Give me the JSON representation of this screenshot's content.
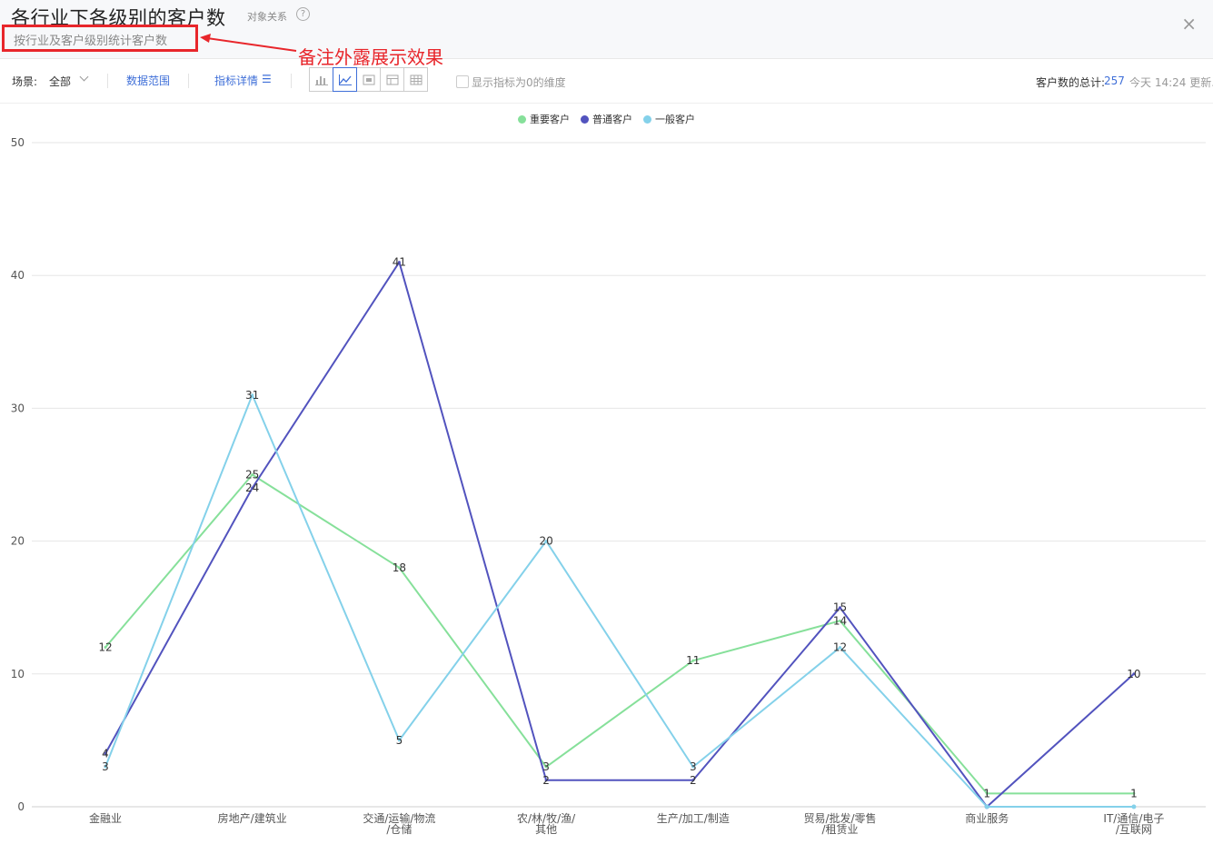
{
  "header": {
    "title": "各行业下各级别的客户数",
    "object_relation": "对象关系",
    "help": "?",
    "close": "×",
    "subtitle": "按行业及客户级别统计客户数",
    "annotation": "备注外露展示效果"
  },
  "toolbar": {
    "scene_label": "场景:",
    "scene_value": "全部",
    "data_range": "数据范围",
    "metric_details": "指标详情",
    "show_zero_label": "显示指标为0的维度",
    "total_label": "客户数的总计:",
    "total_value": "257",
    "update_text": "今天 14:24 更新."
  },
  "colors": {
    "important": "#86e09a",
    "normal": "#5253be",
    "general": "#84d1ea",
    "accent": "#3f6fd8",
    "annotation": "#e8262b"
  },
  "chart_data": {
    "type": "line",
    "categories": [
      "金融业",
      "房地产/建筑业",
      "交通/运输/物流/仓储",
      "农/林/牧/渔/其他",
      "生产/加工/制造",
      "贸易/批发/零售/租赁业",
      "商业服务",
      "IT/通信/电子/互联网"
    ],
    "category_lines": [
      [
        "金融业"
      ],
      [
        "房地产/建筑业"
      ],
      [
        "交通/运输/物流",
        "/仓储"
      ],
      [
        "农/林/牧/渔/",
        "其他"
      ],
      [
        "生产/加工/制造"
      ],
      [
        "贸易/批发/零售",
        "/租赁业"
      ],
      [
        "商业服务"
      ],
      [
        "IT/通信/电子",
        "/互联网"
      ]
    ],
    "series": [
      {
        "name": "重要客户",
        "color": "#86e09a",
        "values": [
          12,
          25,
          18,
          3,
          11,
          14,
          1,
          1
        ],
        "labels": [
          "12",
          "25",
          "18",
          "3",
          "11",
          "14",
          "1",
          "1"
        ]
      },
      {
        "name": "普通客户",
        "color": "#5253be",
        "values": [
          4,
          24,
          41,
          2,
          2,
          15,
          0,
          10
        ],
        "labels": [
          "4",
          "24",
          "41",
          "2",
          "2",
          "15",
          "",
          "10"
        ]
      },
      {
        "name": "一般客户",
        "color": "#84d1ea",
        "values": [
          3,
          31,
          5,
          20,
          3,
          12,
          0,
          0
        ],
        "labels": [
          "3",
          "31",
          "5",
          "20",
          "3",
          "12",
          "",
          ""
        ]
      }
    ],
    "ylim": [
      0,
      50
    ],
    "yticks": [
      0,
      10,
      20,
      30,
      40,
      50
    ],
    "legend_position": "top-center",
    "grid": true
  }
}
